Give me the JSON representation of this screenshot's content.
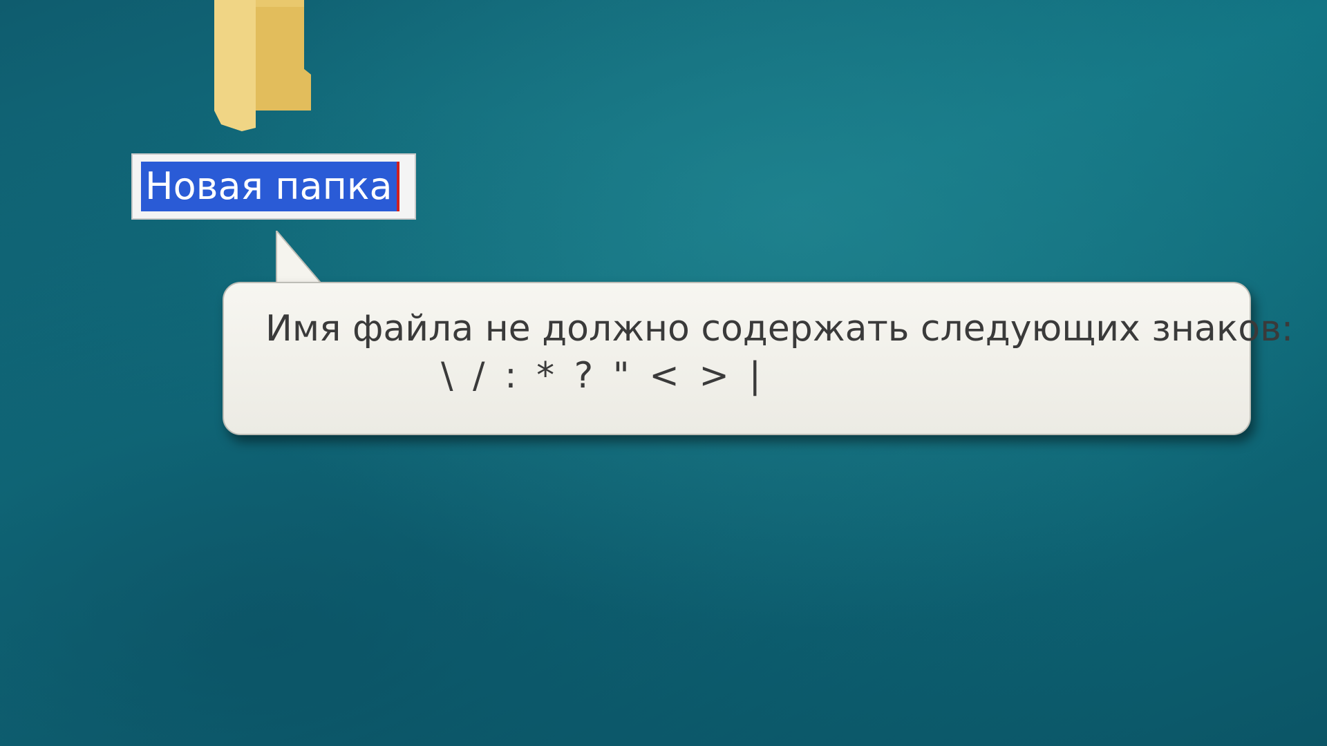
{
  "desktop": {
    "folder": {
      "icon": "folder-icon",
      "name_value": "Новая папка",
      "color": "#e8c56a"
    },
    "tooltip": {
      "message": "Имя файла не должно содержать следующих знаков:",
      "chars": "\\ / : * ? \" < > |"
    }
  },
  "colors": {
    "selection": "#2a5bd6",
    "background": "#127584",
    "tooltip_bg": "#f2f1eb"
  }
}
